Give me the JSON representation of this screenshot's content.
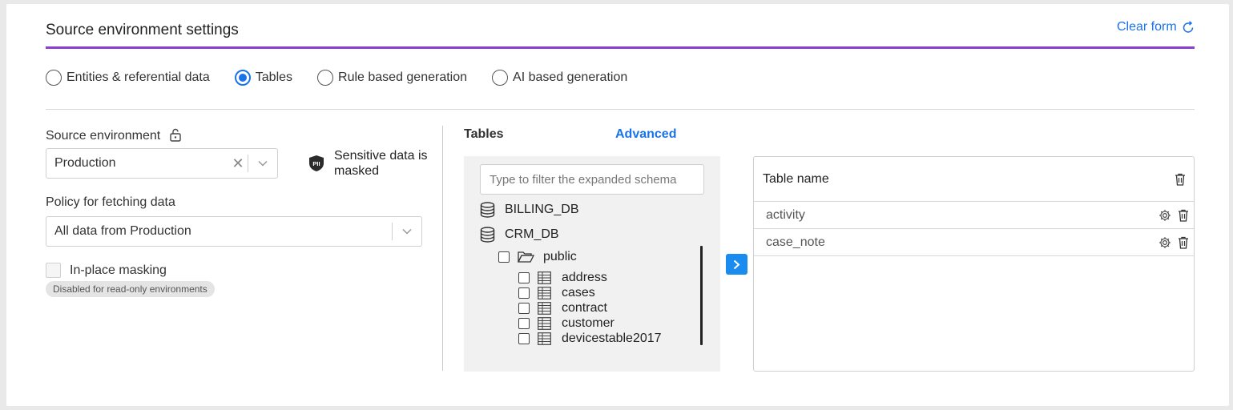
{
  "header": {
    "title": "Source environment settings",
    "clear_label": "Clear form"
  },
  "mode_options": [
    {
      "label": "Entities & referential data",
      "selected": false
    },
    {
      "label": "Tables",
      "selected": true
    },
    {
      "label": "Rule based generation",
      "selected": false
    },
    {
      "label": "AI based generation",
      "selected": false
    }
  ],
  "source_env": {
    "label": "Source environment",
    "value": "Production",
    "pii_line1": "Sensitive data is",
    "pii_line2": "masked",
    "pii_icon_text": "PII"
  },
  "policy": {
    "label": "Policy for fetching data",
    "value": "All data from Production"
  },
  "inplace": {
    "label": "In-place masking",
    "badge": "Disabled for read-only environments"
  },
  "tables_panel": {
    "label": "Tables",
    "advanced": "Advanced",
    "filter_placeholder": "Type to filter the expanded schema",
    "databases": [
      "BILLING_DB",
      "CRM_DB"
    ],
    "schema": "public",
    "tables": [
      "address",
      "cases",
      "contract",
      "customer",
      "devicestable2017"
    ]
  },
  "selected_tables": {
    "header": "Table name",
    "rows": [
      "activity",
      "case_note"
    ]
  },
  "colors": {
    "accent": "#1a73e8",
    "divider_purple": "#8a3fd1",
    "tree_bg": "#f1f1f1"
  }
}
